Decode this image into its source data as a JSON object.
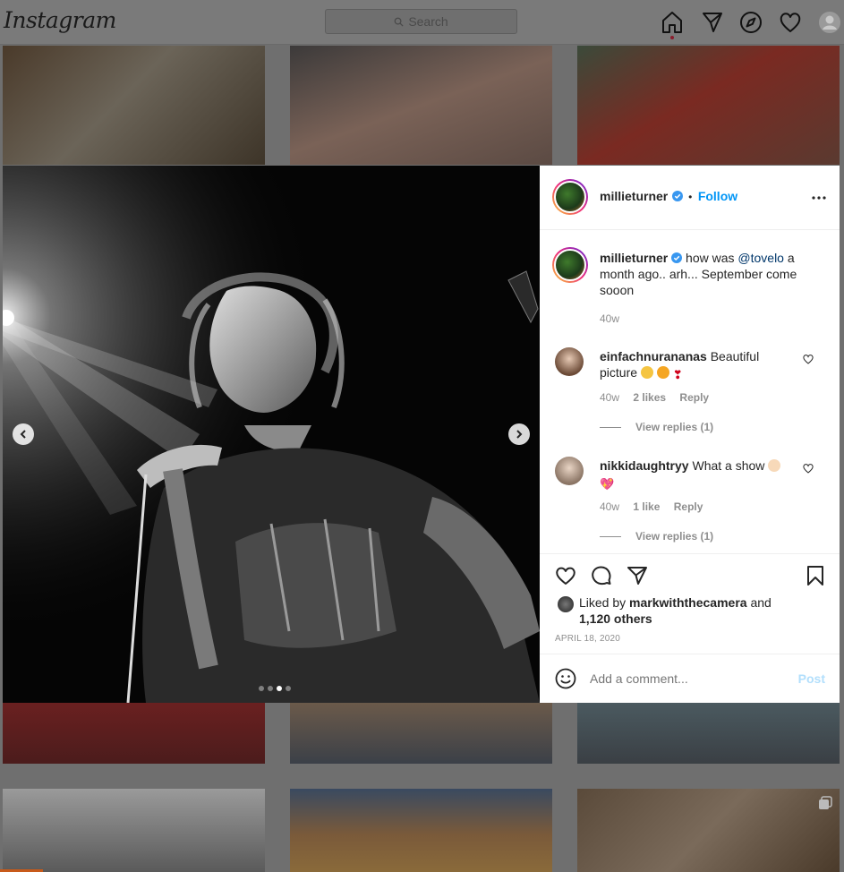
{
  "app": {
    "logo": "Instagram"
  },
  "search": {
    "placeholder": "Search"
  },
  "nav": {
    "icons": [
      "home-icon",
      "direct-icon",
      "explore-icon",
      "activity-heart-icon",
      "profile-avatar"
    ]
  },
  "post": {
    "author": "millieturner",
    "follow_label": "Follow",
    "bullet": "•",
    "caption": {
      "username": "millieturner",
      "text_before": " how was ",
      "mention": "@tovelo",
      "text_after": " a month ago.. arh... September come sooon",
      "age": "40w"
    },
    "carousel": {
      "count": 4,
      "active_index": 2
    },
    "comments": [
      {
        "username": "einfachnurananas",
        "text": " Beautiful picture ",
        "emojis": [
          "pleading-face",
          "star-struck",
          "heart-exclamation"
        ],
        "age": "40w",
        "likes": "2 likes",
        "reply": "Reply",
        "view_replies": "View replies (1)"
      },
      {
        "username": "nikkidaughtryy",
        "text": " What a show ",
        "emojis": [
          "clapping-hands",
          "sparkling-heart"
        ],
        "age": "40w",
        "likes": "1 like",
        "reply": "Reply",
        "view_replies": "View replies (1)"
      }
    ],
    "liked_by": {
      "prefix": "Liked by ",
      "user": "markwiththecamera",
      "middle": " and",
      "others": "1,120 others"
    },
    "date": "APRIL 18, 2020",
    "add_comment_placeholder": "Add a comment...",
    "post_button": "Post"
  },
  "colors": {
    "link_blue": "#0095f6",
    "mention_blue": "#00376b",
    "verified_blue": "#3897f0",
    "post_disabled": "#b2dffc",
    "backdrop": "#6f6f6f"
  }
}
